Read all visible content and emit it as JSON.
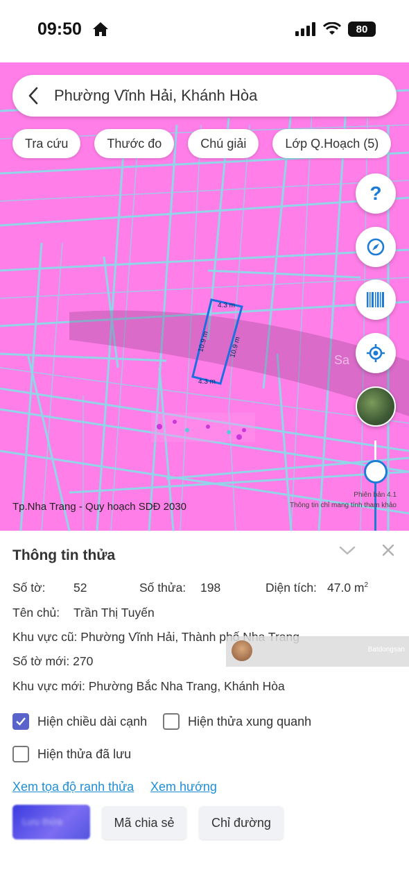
{
  "status_bar": {
    "time": "09:50",
    "battery": "80",
    "icons": [
      "home-icon",
      "signal-icon",
      "wifi-icon",
      "battery-icon"
    ]
  },
  "search": {
    "location": "Phường Vĩnh Hải, Khánh Hòa"
  },
  "chips": [
    {
      "label": "Tra cứu"
    },
    {
      "label": "Thước đo"
    },
    {
      "label": "Chú giải"
    },
    {
      "label": "Lớp Q.Hoạch (5)"
    }
  ],
  "map": {
    "background_color": "#ff7ee8",
    "line_color": "#7fe3e8",
    "parcel_outline_color": "#1b6fe0",
    "parcel_edges": {
      "top": "4.3 m",
      "bottom": "4.3 m",
      "left": "10.9 m",
      "right": "10.9 m"
    },
    "faint_label": "Sa",
    "source_label": "Tp.Nha Trang - Quy hoạch SDĐ 2030",
    "version_line1": "Phiên bản 4.1",
    "version_line2": "Thông tin chỉ mang tính tham khảo",
    "side_buttons": [
      "help-icon",
      "compass-icon",
      "barcode-icon",
      "locate-icon",
      "satellite-layer-thumbnail"
    ],
    "help_glyph": "?"
  },
  "sheet": {
    "title": "Thông tin thửa",
    "so_to_label": "Số tờ:",
    "so_to_value": "52",
    "so_thua_label": "Số thửa:",
    "so_thua_value": "198",
    "dien_tich_label": "Diện tích:",
    "dien_tich_value": "47.0 m",
    "dien_tich_unit_sup": "2",
    "ten_chu_label": "Tên chủ:",
    "ten_chu_value": "Trần Thị Tuyến",
    "khu_vuc_cu": "Khu vực cũ: Phường Vĩnh Hải, Thành phố Nha Trang",
    "so_to_moi": "Số tờ mới: 270",
    "khu_vuc_moi": "Khu vực mới: Phường Bắc Nha Trang, Khánh Hòa",
    "watermark_text": "Batdongsan",
    "checkboxes": [
      {
        "label": "Hiện chiều dài cạnh",
        "checked": true
      },
      {
        "label": "Hiện thửa xung quanh",
        "checked": false
      },
      {
        "label": "Hiện thửa đã lưu",
        "checked": false
      }
    ],
    "links": {
      "coords": "Xem tọa độ ranh thửa",
      "direction": "Xem hướng"
    },
    "buttons": {
      "blurred": "Lưu thửa",
      "share": "Mã chia sẻ",
      "directions": "Chỉ đường"
    }
  }
}
